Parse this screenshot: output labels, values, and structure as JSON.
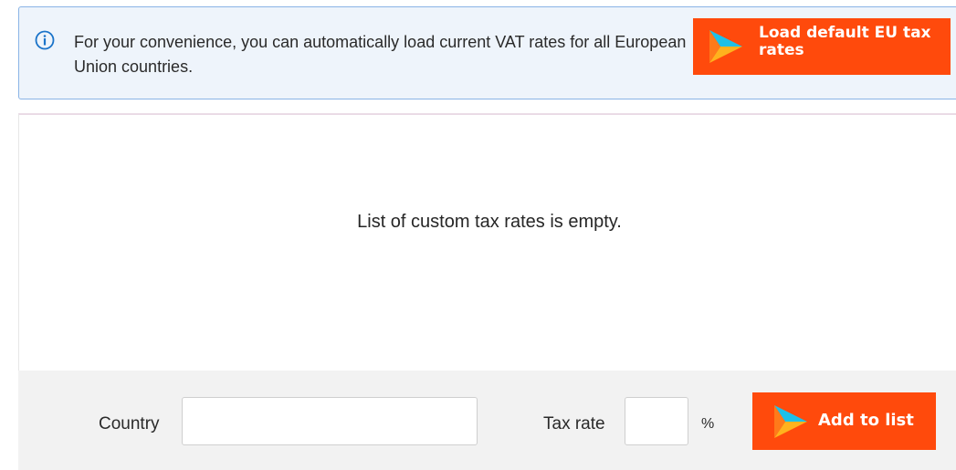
{
  "banner": {
    "icon": "info-icon",
    "text": "For your convenience, you can automatically load current VAT rates for all European Union countries.",
    "load_button_label": "Load default EU tax rates"
  },
  "list": {
    "empty_message": "List of custom tax rates is empty."
  },
  "form": {
    "country_label": "Country",
    "country_value": "",
    "tax_rate_label": "Tax rate",
    "tax_rate_value": "",
    "percent_symbol": "%",
    "add_button_label": "Add to list"
  },
  "colors": {
    "accent": "#ff4a0c",
    "banner_bg": "#eef4fb",
    "banner_border": "#8ab4e6",
    "info_icon": "#1a73c9",
    "form_bg": "#f2f2f2"
  }
}
